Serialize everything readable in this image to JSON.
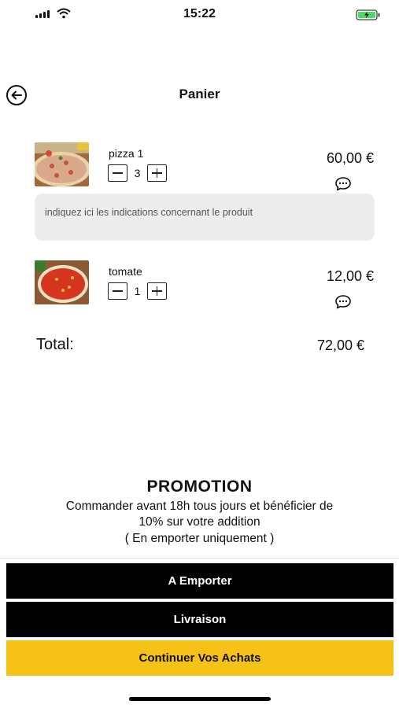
{
  "status": {
    "time": "15:22"
  },
  "header": {
    "title": "Panier",
    "back_icon": "arrow-left-circle-icon"
  },
  "cart": {
    "items": [
      {
        "name": "pizza 1",
        "quantity": "3",
        "price": "60,00 €",
        "image": "pizza-thumbnail"
      },
      {
        "name": "tomate",
        "quantity": "1",
        "price": "12,00 €",
        "image": "pizza-thumbnail"
      }
    ],
    "note_placeholder": "indiquez ici les indications concernant le produit"
  },
  "total": {
    "label": "Total:",
    "value": "72,00 €"
  },
  "promo": {
    "title": "PROMOTION",
    "line1": "Commander avant 18h tous jours et  bénéficier  de",
    "line2": "10% sur votre addition",
    "line3": "( En emporter uniquement )"
  },
  "actions": {
    "takeaway": "A Emporter",
    "delivery": "Livraison",
    "continue": "Continuer Vos Achats"
  },
  "colors": {
    "accent": "#f6c218",
    "dark_button": "#000000",
    "note_bg": "#ededed"
  }
}
